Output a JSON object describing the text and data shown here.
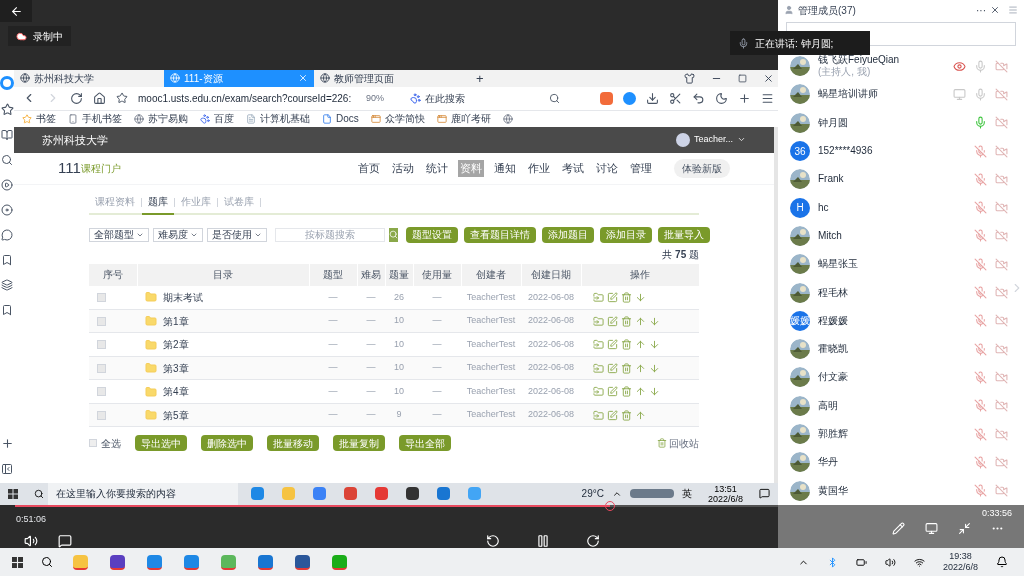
{
  "top_bar": {
    "recording_badge": "录制中",
    "speaker_pill": "正在讲话: 钟月圆;"
  },
  "browser": {
    "tabs": [
      {
        "label": "苏州科技大学",
        "selected": false
      },
      {
        "label": "111-资源",
        "selected": true
      },
      {
        "label": "教师管理页面",
        "selected": false
      }
    ],
    "new_tab": "+",
    "url": "mooc1.usts.edu.cn/exam/search?courseId=226:",
    "zoom": "90%",
    "search_placeholder": "在此搜索",
    "bookmarks": [
      "书签",
      "手机书签",
      "苏宁易购",
      "百度",
      "计算机基础",
      "Docs",
      "众学简快",
      "鹿吖考研"
    ]
  },
  "site": {
    "school": "苏州科技大学",
    "user": "Teacher...",
    "course_code": "111",
    "course_portal": "课程门户",
    "nav": [
      {
        "label": "首页",
        "selected": false
      },
      {
        "label": "活动",
        "selected": false
      },
      {
        "label": "统计",
        "selected": false
      },
      {
        "label": "资料",
        "selected": true
      },
      {
        "label": "通知",
        "selected": false
      },
      {
        "label": "作业",
        "selected": false
      },
      {
        "label": "考试",
        "selected": false
      },
      {
        "label": "讨论",
        "selected": false
      },
      {
        "label": "管理",
        "selected": false
      }
    ],
    "new_version": "体验新版",
    "subtabs": [
      {
        "label": "课程资料",
        "selected": false
      },
      {
        "label": "题库",
        "selected": true
      },
      {
        "label": "作业库",
        "selected": false
      },
      {
        "label": "试卷库",
        "selected": false
      }
    ],
    "filters": [
      "全部题型",
      "难易度",
      "是否使用"
    ],
    "search_placeholder": "按标题搜索",
    "actions": [
      "题型设置",
      "查看题目详情",
      "添加题目",
      "添加目录",
      "批量导入"
    ],
    "total": "共 **75** 题",
    "table": {
      "columns": [
        "序号",
        "目录",
        "题型",
        "难易",
        "题量",
        "使用量",
        "创建者",
        "创建日期",
        "操作"
      ],
      "rows": [
        {
          "checked": false,
          "name": "期末考试",
          "type": "—",
          "difficulty": "—",
          "count": "26",
          "usage": "—",
          "creator": "TeacherTest",
          "date": "2022-06-08",
          "up": false,
          "down": true
        },
        {
          "checked": false,
          "name": "第1章",
          "type": "—",
          "difficulty": "—",
          "count": "10",
          "usage": "—",
          "creator": "TeacherTest",
          "date": "2022-06-08",
          "up": true,
          "down": true
        },
        {
          "checked": false,
          "name": "第2章",
          "type": "—",
          "difficulty": "—",
          "count": "10",
          "usage": "—",
          "creator": "TeacherTest",
          "date": "2022-06-08",
          "up": true,
          "down": true
        },
        {
          "checked": false,
          "name": "第3章",
          "type": "—",
          "difficulty": "—",
          "count": "10",
          "usage": "—",
          "creator": "TeacherTest",
          "date": "2022-06-08",
          "up": true,
          "down": true
        },
        {
          "checked": false,
          "name": "第4章",
          "type": "—",
          "difficulty": "—",
          "count": "10",
          "usage": "—",
          "creator": "TeacherTest",
          "date": "2022-06-08",
          "up": true,
          "down": true
        },
        {
          "checked": false,
          "name": "第5章",
          "type": "—",
          "difficulty": "—",
          "count": "9",
          "usage": "—",
          "creator": "TeacherTest",
          "date": "2022-06-08",
          "up": true,
          "down": false
        }
      ]
    },
    "select_all": {
      "label": "全选",
      "checked": false
    },
    "bulk_actions": [
      "导出选中",
      "删除选中",
      "批量移动",
      "批量复制",
      "导出全部"
    ],
    "recycle_bin": "回收站"
  },
  "video_taskbar": {
    "search_placeholder": "在这里输入你要搜索的内容",
    "weather": "29°C",
    "ime": "英",
    "time": "13:51",
    "date": "2022/6/8"
  },
  "player": {
    "elapsed": "0:51:06",
    "progress": {
      "level": 0.78
    }
  },
  "members": {
    "title": "管理成员(37)",
    "more": "···",
    "items": [
      {
        "name": "钱飞跃FeiyueQian",
        "note": "(主持人, 我)",
        "watching": true,
        "screen_sharing": false,
        "muted": false,
        "speaking": false
      },
      {
        "name": "蜗星培训讲师",
        "watching": false,
        "screen_sharing": true,
        "muted": false,
        "speaking": false
      },
      {
        "name": "钟月圆",
        "watching": false,
        "screen_sharing": false,
        "muted": false,
        "speaking": true
      },
      {
        "name": "152****4936",
        "avatar": {
          "kind": "initials",
          "initials": "36",
          "color": "#1a73e8"
        },
        "watching": false,
        "screen_sharing": false,
        "muted": true,
        "speaking": false
      },
      {
        "name": "Frank",
        "watching": false,
        "screen_sharing": false,
        "muted": true,
        "speaking": false
      },
      {
        "name": "hc",
        "avatar": {
          "kind": "initials",
          "initials": "H",
          "color": "#1a73e8"
        },
        "watching": false,
        "screen_sharing": false,
        "muted": true,
        "speaking": false
      },
      {
        "name": "Mitch",
        "watching": false,
        "screen_sharing": false,
        "muted": true,
        "speaking": false
      },
      {
        "name": "蜗星张玉",
        "watching": false,
        "screen_sharing": false,
        "muted": true,
        "speaking": false
      },
      {
        "name": "程毛林",
        "watching": false,
        "screen_sharing": false,
        "muted": true,
        "speaking": false
      },
      {
        "name": "程媛媛",
        "avatar": {
          "kind": "initials",
          "initials": "媛媛",
          "color": "#1a73e8"
        },
        "watching": false,
        "screen_sharing": false,
        "muted": true,
        "speaking": false
      },
      {
        "name": "霍晓凯",
        "watching": false,
        "screen_sharing": false,
        "muted": true,
        "speaking": false
      },
      {
        "name": "付文豪",
        "watching": false,
        "screen_sharing": false,
        "muted": true,
        "speaking": false
      },
      {
        "name": "高明",
        "watching": false,
        "screen_sharing": false,
        "muted": true,
        "speaking": false
      },
      {
        "name": "郭胜辉",
        "watching": false,
        "screen_sharing": false,
        "muted": true,
        "speaking": false
      },
      {
        "name": "华丹",
        "watching": false,
        "screen_sharing": false,
        "muted": true,
        "speaking": false
      },
      {
        "name": "黄国华",
        "watching": false,
        "screen_sharing": false,
        "muted": true,
        "speaking": false
      }
    ],
    "remaining_time": "0:33:56"
  },
  "taskbar": {
    "time": "19:38",
    "date": "2022/6/8"
  }
}
